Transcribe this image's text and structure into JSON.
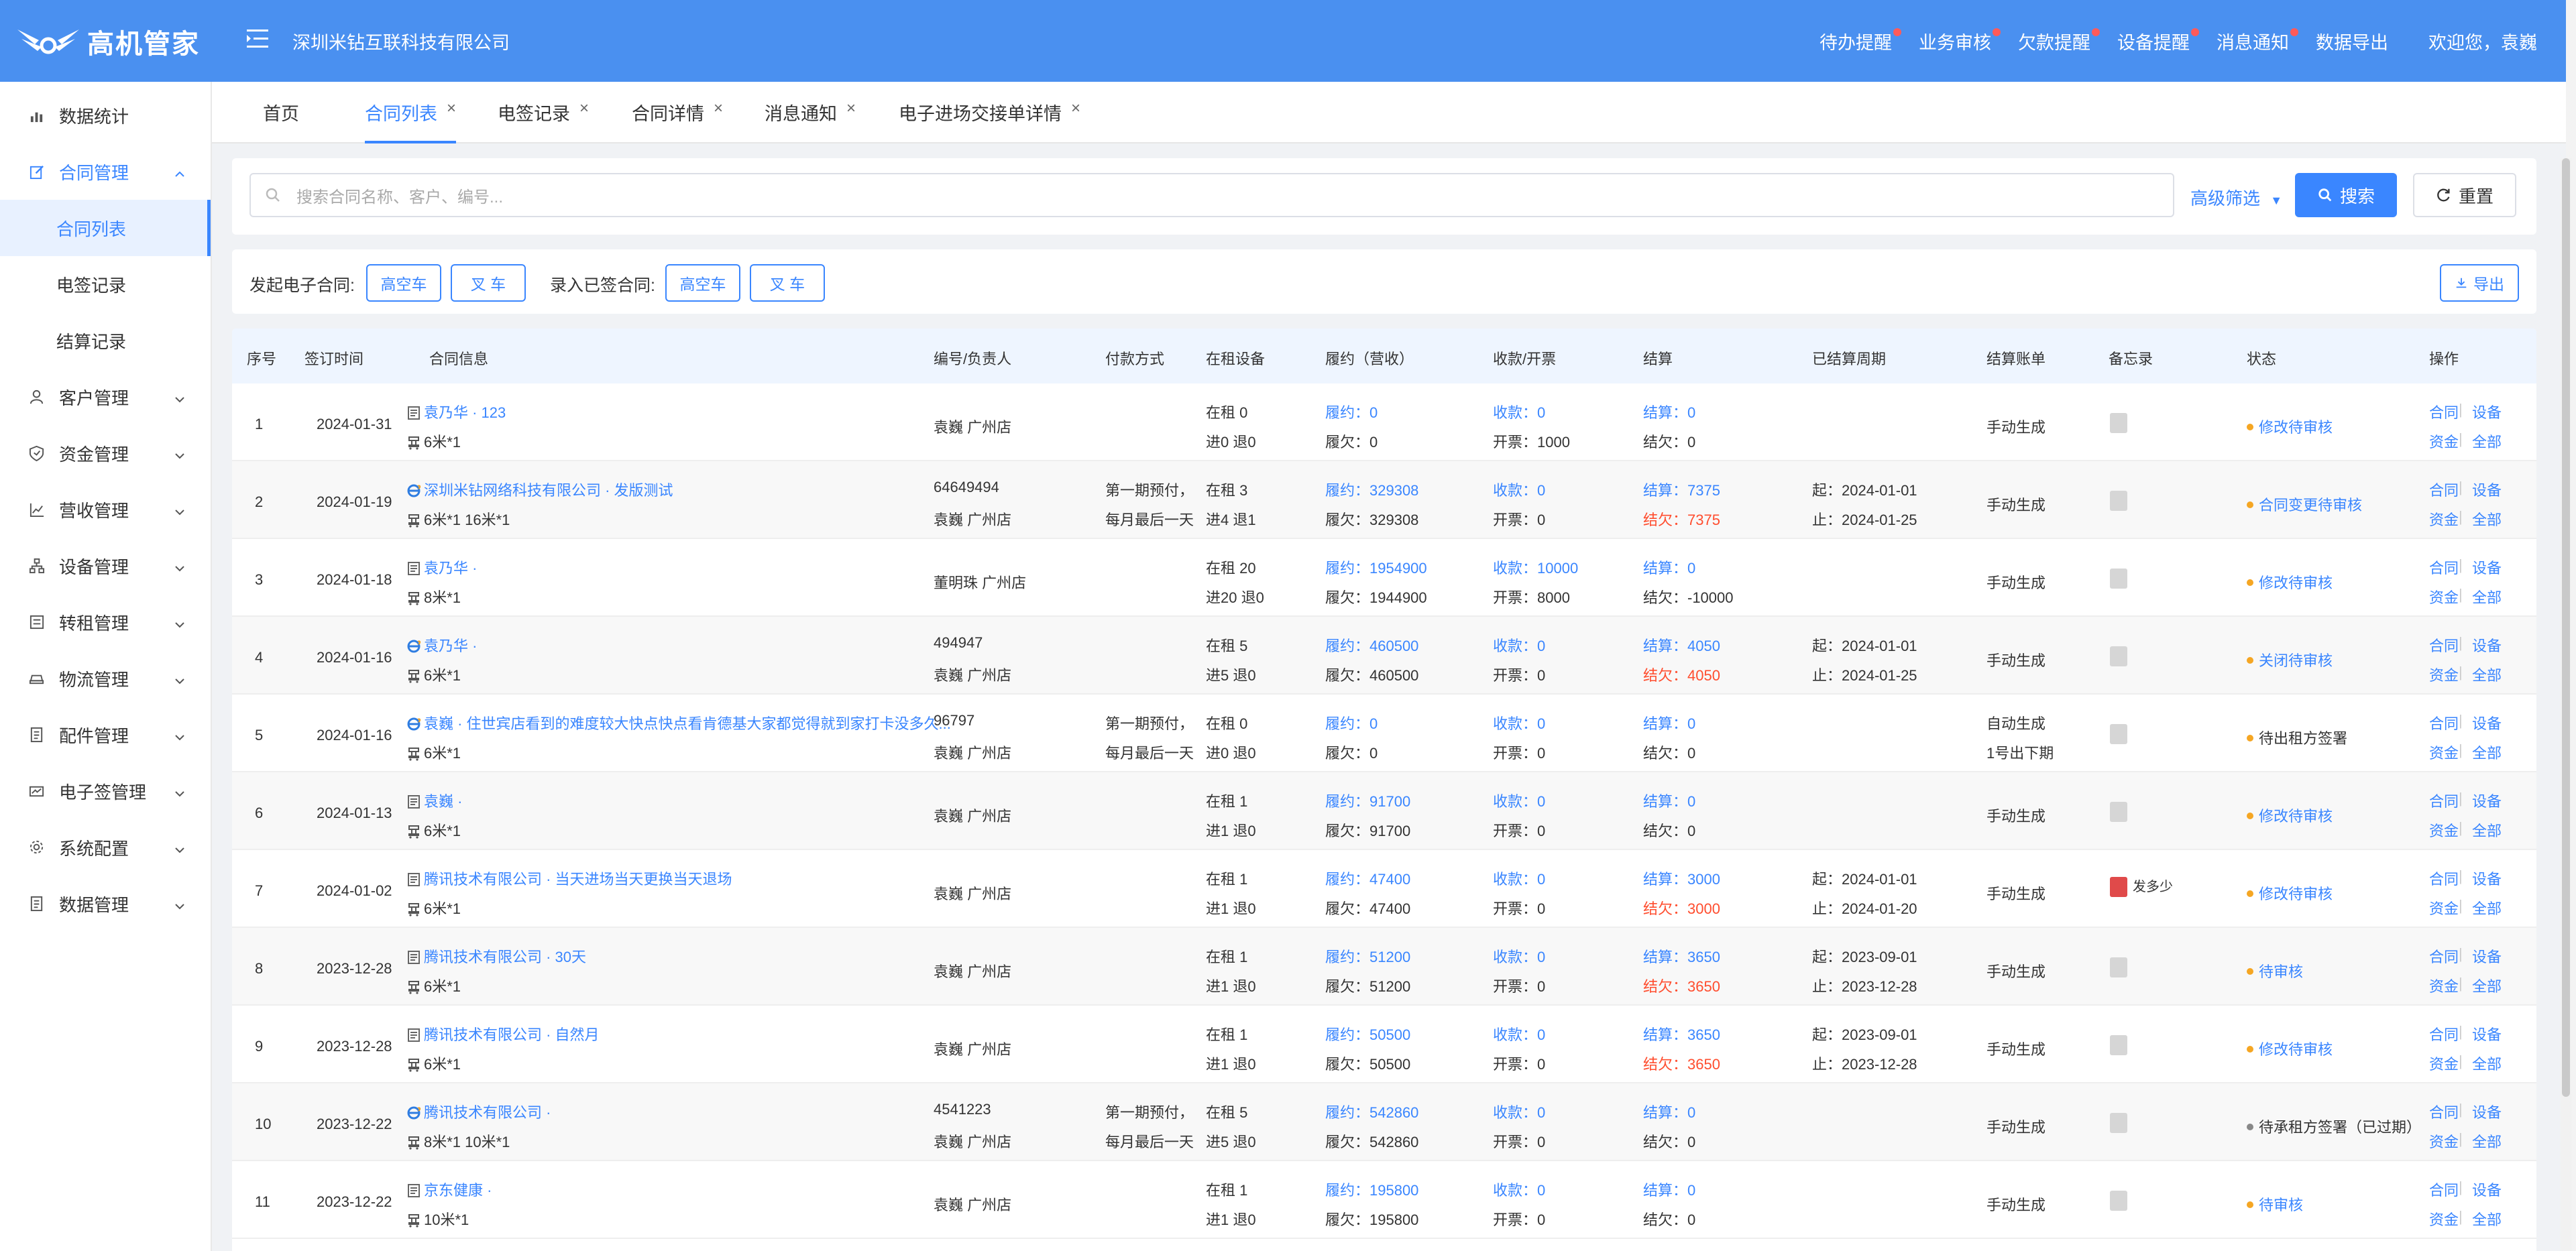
{
  "header": {
    "logo_text": "高机管家",
    "company": "深圳米钻互联科技有限公司",
    "nav": [
      {
        "label": "待办提醒",
        "dot": true
      },
      {
        "label": "业务审核",
        "dot": true
      },
      {
        "label": "欠款提醒",
        "dot": true
      },
      {
        "label": "设备提醒",
        "dot": true
      },
      {
        "label": "消息通知",
        "dot": true
      },
      {
        "label": "数据导出",
        "dot": false
      }
    ],
    "welcome": "欢迎您，袁巍"
  },
  "sidebar": {
    "items": [
      {
        "label": "数据统计",
        "icon": "bar-chart-icon"
      },
      {
        "label": "合同管理",
        "icon": "edit-icon"
      },
      {
        "label": "客户管理",
        "icon": "user-icon"
      },
      {
        "label": "资金管理",
        "icon": "shield-icon"
      },
      {
        "label": "营收管理",
        "icon": "line-chart-icon"
      },
      {
        "label": "设备管理",
        "icon": "network-icon"
      },
      {
        "label": "转租管理",
        "icon": "list-icon"
      },
      {
        "label": "物流管理",
        "icon": "car-icon"
      },
      {
        "label": "配件管理",
        "icon": "doc-icon"
      },
      {
        "label": "电子签管理",
        "icon": "sign-icon"
      },
      {
        "label": "系统配置",
        "icon": "gear-icon"
      },
      {
        "label": "数据管理",
        "icon": "doc-icon"
      }
    ],
    "sub_items": [
      "合同列表",
      "电签记录",
      "结算记录"
    ]
  },
  "tabs": [
    {
      "label": "首页",
      "closable": false
    },
    {
      "label": "合同列表",
      "closable": true
    },
    {
      "label": "电签记录",
      "closable": true
    },
    {
      "label": "合同详情",
      "closable": true
    },
    {
      "label": "消息通知",
      "closable": true
    },
    {
      "label": "电子进场交接单详情",
      "closable": true
    }
  ],
  "search": {
    "placeholder": "搜索合同名称、客户、编号...",
    "advanced": "高级筛选",
    "search_btn": "搜索",
    "reset_btn": "重置"
  },
  "actions": {
    "launch_label": "发起电子合同:",
    "record_label": "录入已签合同:",
    "btn_aerial": "高空车",
    "btn_fork": "叉 车",
    "export": "导出"
  },
  "table": {
    "headers": [
      "序号",
      "签订时间",
      "合同信息",
      "编号/负责人",
      "付款方式",
      "在租设备",
      "履约（营收）",
      "收款/开票",
      "结算",
      "已结算周期",
      "结算账单",
      "备忘录",
      "状态",
      "操作"
    ],
    "op_labels": {
      "contract": "合同",
      "device": "设备",
      "fund": "资金",
      "all": "全部"
    },
    "rows": [
      {
        "no": "1",
        "date": "2024-01-31",
        "info_type": "doc",
        "info": "袁乃华 · 123",
        "spec": "6米*1",
        "code": "",
        "owner": "袁巍   广州店",
        "pay1": "",
        "pay2": "",
        "rent1": "在租 0",
        "rent2": "进0   退0",
        "perf": "履约：0",
        "owe": "履欠：0",
        "recv": "收款：0",
        "invoice": "开票：1000",
        "settle": "结算：0",
        "settle_owe": "结欠：0",
        "settle_owe_red": false,
        "period1": "",
        "period2": "",
        "bill1": "手动生成",
        "bill2": "",
        "memo": "",
        "status": "修改待审核",
        "status_blue": true,
        "status_gray": false
      },
      {
        "no": "2",
        "date": "2024-01-19",
        "info_type": "ie",
        "info": "深圳米钻网络科技有限公司 · 发版测试",
        "spec": "6米*1   16米*1",
        "code": "64649494",
        "owner": "袁巍   广州店",
        "pay1": "第一期预付，",
        "pay2": "每月最后一天",
        "rent1": "在租 3",
        "rent2": "进4   退1",
        "perf": "履约：329308",
        "owe": "履欠：329308",
        "recv": "收款：0",
        "invoice": "开票：0",
        "settle": "结算：7375",
        "settle_owe": "结欠：7375",
        "settle_owe_red": true,
        "period1": "起：2024-01-01",
        "period2": "止：2024-01-25",
        "bill1": "手动生成",
        "bill2": "",
        "memo": "",
        "status": "合同变更待审核",
        "status_blue": true,
        "status_gray": false
      },
      {
        "no": "3",
        "date": "2024-01-18",
        "info_type": "doc",
        "info": "袁乃华 ·",
        "spec": "8米*1",
        "code": "",
        "owner": "董明珠   广州店",
        "pay1": "",
        "pay2": "",
        "rent1": "在租 20",
        "rent2": "进20   退0",
        "perf": "履约：1954900",
        "owe": "履欠：1944900",
        "recv": "收款：10000",
        "invoice": "开票：8000",
        "settle": "结算：0",
        "settle_owe": "结欠：-10000",
        "settle_owe_red": false,
        "period1": "",
        "period2": "",
        "bill1": "手动生成",
        "bill2": "",
        "memo": "",
        "status": "修改待审核",
        "status_blue": true,
        "status_gray": false
      },
      {
        "no": "4",
        "date": "2024-01-16",
        "info_type": "ie",
        "info": "袁乃华 ·",
        "spec": "6米*1",
        "code": "494947",
        "owner": "袁巍   广州店",
        "pay1": "",
        "pay2": "",
        "rent1": "在租 5",
        "rent2": "进5   退0",
        "perf": "履约：460500",
        "owe": "履欠：460500",
        "recv": "收款：0",
        "invoice": "开票：0",
        "settle": "结算：4050",
        "settle_owe": "结欠：4050",
        "settle_owe_red": true,
        "period1": "起：2024-01-01",
        "period2": "止：2024-01-25",
        "bill1": "手动生成",
        "bill2": "",
        "memo": "",
        "status": "关闭待审核",
        "status_blue": true,
        "status_gray": false
      },
      {
        "no": "5",
        "date": "2024-01-16",
        "info_type": "ie",
        "info": "袁巍 · 住世宾店看到的难度较大快点快点看肯德基大家都觉得就到家打卡没多久...",
        "spec": "6米*1",
        "code": "96797",
        "owner": "袁巍   广州店",
        "pay1": "第一期预付，",
        "pay2": "每月最后一天",
        "rent1": "在租 0",
        "rent2": "进0   退0",
        "perf": "履约：0",
        "owe": "履欠：0",
        "recv": "收款：0",
        "invoice": "开票：0",
        "settle": "结算：0",
        "settle_owe": "结欠：0",
        "settle_owe_red": false,
        "period1": "",
        "period2": "",
        "bill1": "自动生成",
        "bill2": "1号出下期",
        "memo": "",
        "status": "待出租方签署",
        "status_blue": false,
        "status_gray": false
      },
      {
        "no": "6",
        "date": "2024-01-13",
        "info_type": "doc",
        "info": "袁巍 ·",
        "spec": "6米*1",
        "code": "",
        "owner": "袁巍   广州店",
        "pay1": "",
        "pay2": "",
        "rent1": "在租 1",
        "rent2": "进1   退0",
        "perf": "履约：91700",
        "owe": "履欠：91700",
        "recv": "收款：0",
        "invoice": "开票：0",
        "settle": "结算：0",
        "settle_owe": "结欠：0",
        "settle_owe_red": false,
        "period1": "",
        "period2": "",
        "bill1": "手动生成",
        "bill2": "",
        "memo": "",
        "status": "修改待审核",
        "status_blue": true,
        "status_gray": false
      },
      {
        "no": "7",
        "date": "2024-01-02",
        "info_type": "doc",
        "info": "腾讯技术有限公司 · 当天进场当天更换当天退场",
        "spec": "6米*1",
        "code": "",
        "owner": "袁巍   广州店",
        "pay1": "",
        "pay2": "",
        "rent1": "在租 1",
        "rent2": "进1   退0",
        "perf": "履约：47400",
        "owe": "履欠：47400",
        "recv": "收款：0",
        "invoice": "开票：0",
        "settle": "结算：3000",
        "settle_owe": "结欠：3000",
        "settle_owe_red": true,
        "period1": "起：2024-01-01",
        "period2": "止：2024-01-20",
        "bill1": "手动生成",
        "bill2": "",
        "memo": "发多少",
        "status": "修改待审核",
        "status_blue": true,
        "status_gray": false
      },
      {
        "no": "8",
        "date": "2023-12-28",
        "info_type": "doc",
        "info": "腾讯技术有限公司 · 30天",
        "spec": "6米*1",
        "code": "",
        "owner": "袁巍   广州店",
        "pay1": "",
        "pay2": "",
        "rent1": "在租 1",
        "rent2": "进1   退0",
        "perf": "履约：51200",
        "owe": "履欠：51200",
        "recv": "收款：0",
        "invoice": "开票：0",
        "settle": "结算：3650",
        "settle_owe": "结欠：3650",
        "settle_owe_red": true,
        "period1": "起：2023-09-01",
        "period2": "止：2023-12-28",
        "bill1": "手动生成",
        "bill2": "",
        "memo": "",
        "status": "待审核",
        "status_blue": true,
        "status_gray": false
      },
      {
        "no": "9",
        "date": "2023-12-28",
        "info_type": "doc",
        "info": "腾讯技术有限公司 · 自然月",
        "spec": "6米*1",
        "code": "",
        "owner": "袁巍   广州店",
        "pay1": "",
        "pay2": "",
        "rent1": "在租 1",
        "rent2": "进1   退0",
        "perf": "履约：50500",
        "owe": "履欠：50500",
        "recv": "收款：0",
        "invoice": "开票：0",
        "settle": "结算：3650",
        "settle_owe": "结欠：3650",
        "settle_owe_red": true,
        "period1": "起：2023-09-01",
        "period2": "止：2023-12-28",
        "bill1": "手动生成",
        "bill2": "",
        "memo": "",
        "status": "修改待审核",
        "status_blue": true,
        "status_gray": false
      },
      {
        "no": "10",
        "date": "2023-12-22",
        "info_type": "ie",
        "info": "腾讯技术有限公司 ·",
        "spec": "8米*1   10米*1",
        "code": "4541223",
        "owner": "袁巍   广州店",
        "pay1": "第一期预付，",
        "pay2": "每月最后一天",
        "rent1": "在租 5",
        "rent2": "进5   退0",
        "perf": "履约：542860",
        "owe": "履欠：542860",
        "recv": "收款：0",
        "invoice": "开票：0",
        "settle": "结算：0",
        "settle_owe": "结欠：0",
        "settle_owe_red": false,
        "period1": "",
        "period2": "",
        "bill1": "手动生成",
        "bill2": "",
        "memo": "",
        "status": "待承租方签署（已过期）",
        "status_blue": false,
        "status_gray": true
      },
      {
        "no": "11",
        "date": "2023-12-22",
        "info_type": "doc",
        "info": "京东健康 ·",
        "spec": "10米*1",
        "code": "",
        "owner": "袁巍   广州店",
        "pay1": "",
        "pay2": "",
        "rent1": "在租 1",
        "rent2": "进1   退0",
        "perf": "履约：195800",
        "owe": "履欠：195800",
        "recv": "收款：0",
        "invoice": "开票：0",
        "settle": "结算：0",
        "settle_owe": "结欠：0",
        "settle_owe_red": false,
        "period1": "",
        "period2": "",
        "bill1": "手动生成",
        "bill2": "",
        "memo": "",
        "status": "待审核",
        "status_blue": true,
        "status_gray": false
      }
    ]
  },
  "colors": {
    "primary": "#3a86ff",
    "header": "#4a90f0",
    "danger": "#ff4d2e",
    "warning": "#f5a623"
  }
}
